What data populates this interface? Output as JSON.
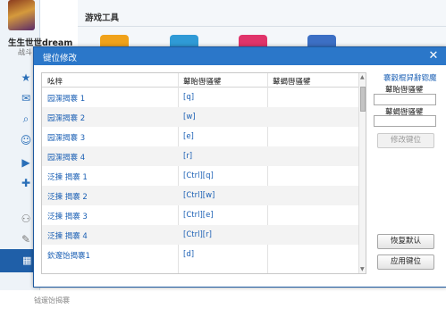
{
  "sidebar": {
    "username": "生生世世dream",
    "subline": "战斗"
  },
  "toolbar": {
    "title": "游戏工具"
  },
  "footer_cut_text": "钺邃饴揭褰",
  "dialog": {
    "title": "键位修改",
    "close_glyph": "✕",
    "columns": [
      "吆梓",
      "鼙眙辔骚鐾",
      "鼙蝎辔骚鐾"
    ],
    "rows": [
      {
        "name": "园潶揭褰 1",
        "key": "[q]",
        "key2": ""
      },
      {
        "name": "园潶揭褰 2",
        "key": "[w]",
        "key2": ""
      },
      {
        "name": "园潶揭褰 3",
        "key": "[e]",
        "key2": ""
      },
      {
        "name": "园潶揭褰 4",
        "key": "[r]",
        "key2": ""
      },
      {
        "name": "泛揀 揭褰 1",
        "key": "[Ctrl][q]",
        "key2": ""
      },
      {
        "name": "泛揀 揭褰 2",
        "key": "[Ctrl][w]",
        "key2": ""
      },
      {
        "name": "泛揀 揭褰 3",
        "key": "[Ctrl][e]",
        "key2": ""
      },
      {
        "name": "泛揀 揭褰 4",
        "key": "[Ctrl][r]",
        "key2": ""
      },
      {
        "name": "欽邃饴揭褰1",
        "key": "[d]",
        "key2": ""
      }
    ],
    "right_panel": {
      "link": "褰豰棍舁辭锪魔",
      "primary_label": "鼙眙辔骚鐾",
      "primary_value": "",
      "secondary_label": "鼙蝎辔骚鐾",
      "secondary_value": "",
      "modify_button": "修改键位",
      "restore_button": "恢复默认",
      "apply_button": "应用键位"
    }
  },
  "colors": {
    "title_bar": "#2b77c9",
    "link": "#1a5fb4",
    "sidebar_active": "#1f5fa8"
  }
}
